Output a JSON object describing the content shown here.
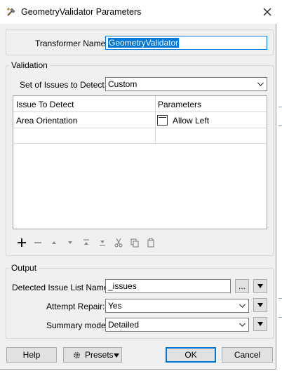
{
  "window": {
    "title": "GeometryValidator Parameters",
    "icon": "transformer-icon",
    "close_icon": "close-icon"
  },
  "transformer": {
    "label": "Transformer Name:",
    "value": "GeometryValidator"
  },
  "validation": {
    "legend": "Validation",
    "issues_label": "Set of Issues to Detect:",
    "issues_value": "Custom",
    "table": {
      "columns": [
        "Issue To Detect",
        "Parameters"
      ],
      "rows": [
        {
          "issue": "Area Orientation",
          "parameter": "Allow Left",
          "checked": false
        }
      ]
    },
    "toolbar": [
      "add-icon",
      "remove-icon",
      "move-up-icon",
      "move-down-icon",
      "move-top-icon",
      "move-bottom-icon",
      "cut-icon",
      "copy-icon",
      "paste-icon"
    ]
  },
  "output": {
    "legend": "Output",
    "issue_list_label": "Detected Issue List Name:",
    "issue_list_value": "_issues",
    "ellipsis": "...",
    "repair_label": "Attempt Repair:",
    "repair_value": "Yes",
    "summary_label": "Summary mode:",
    "summary_value": "Detailed"
  },
  "buttons": {
    "help": "Help",
    "presets": "Presets",
    "ok": "OK",
    "cancel": "Cancel"
  }
}
